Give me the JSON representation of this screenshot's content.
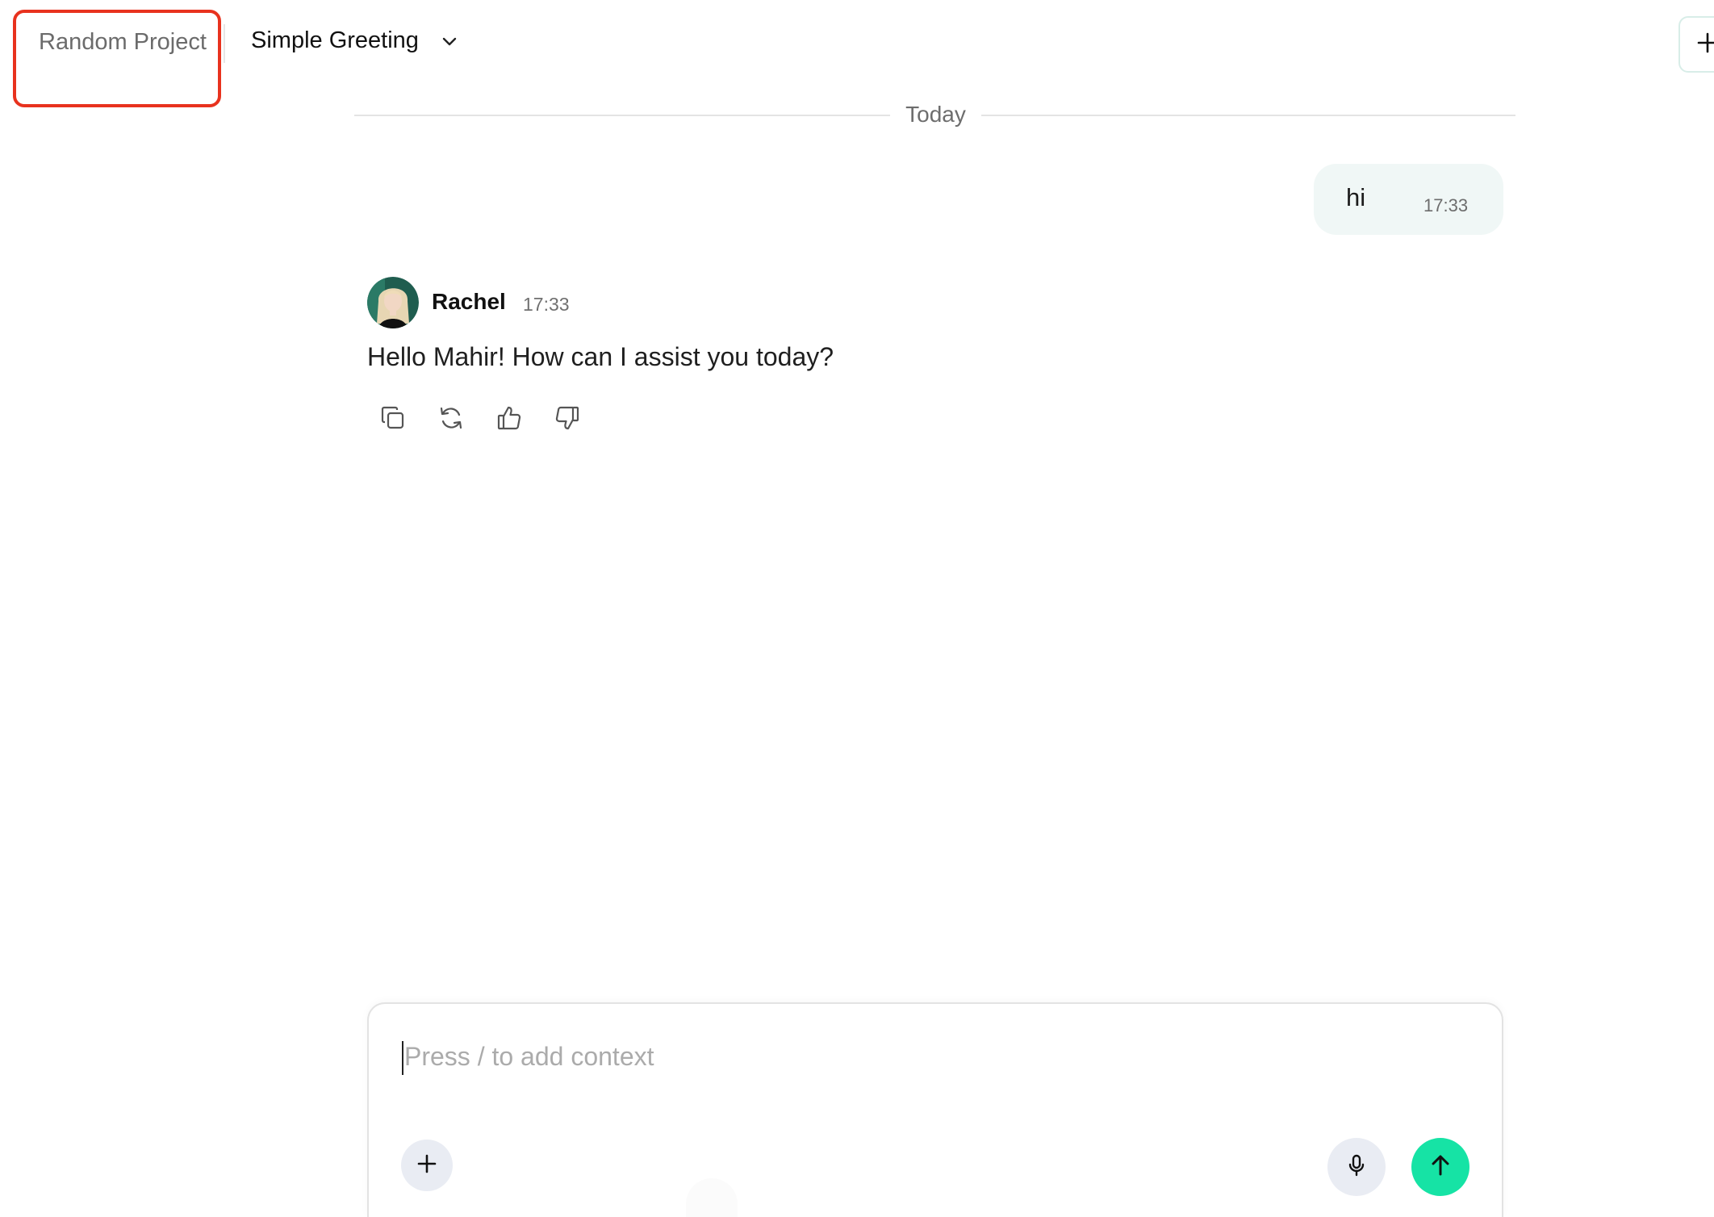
{
  "header": {
    "project_name": "Random Project",
    "chat_title": "Simple Greeting"
  },
  "conversation": {
    "day_label": "Today",
    "user_message": {
      "text": "hi",
      "time": "17:33"
    },
    "assistant_message": {
      "name": "Rachel",
      "time": "17:33",
      "text": "Hello Mahir! How can I assist you today?"
    },
    "actions": [
      "copy-icon",
      "regenerate-icon",
      "thumbs-up-icon",
      "thumbs-down-icon"
    ]
  },
  "composer": {
    "placeholder": "Press / to add context",
    "value": ""
  },
  "colors": {
    "accent": "#16e3a5",
    "highlight": "#e8321e",
    "user_bubble": "#f0f7f6",
    "secondary_button": "#e9ecf3"
  }
}
